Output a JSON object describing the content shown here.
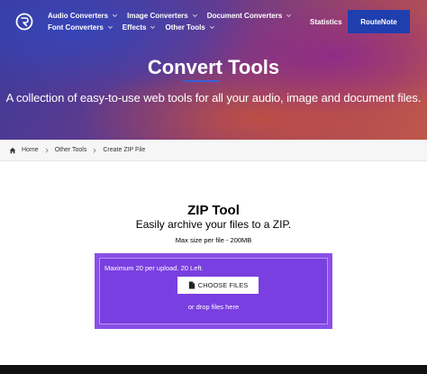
{
  "header": {
    "nav_row1": [
      {
        "label": "Audio Converters",
        "has_dropdown": true
      },
      {
        "label": "Image Converters",
        "has_dropdown": true
      },
      {
        "label": "Document Converters",
        "has_dropdown": true
      }
    ],
    "nav_row2": [
      {
        "label": "Font Converters",
        "has_dropdown": true
      },
      {
        "label": "Effects",
        "has_dropdown": true
      },
      {
        "label": "Other Tools",
        "has_dropdown": true
      }
    ],
    "statistics_label": "Statistics",
    "routenote_label": "RouteNote"
  },
  "hero": {
    "title": "Convert Tools",
    "subtitle": "A collection of easy-to-use web tools for all your audio, image and document files."
  },
  "breadcrumb": {
    "items": [
      "Home",
      "Other Tools",
      "Create ZIP File"
    ]
  },
  "tool": {
    "title": "ZIP Tool",
    "subtitle": "Easily archive your files to a ZIP.",
    "max_size": "Max size per file - 200MB",
    "upload_limit": "Maximum 20 per upload. 20 Left.",
    "choose_files_label": "CHOOSE FILES",
    "drop_text": "or drop files here"
  },
  "colors": {
    "brand_button": "#1f3fae",
    "dropzone": "#7a3fe0",
    "dropzone_border": "#8a4fe6"
  },
  "icons": {
    "logo": "routenote-logo-icon",
    "dropdown": "chevron-down-icon",
    "home": "home-icon",
    "separator": "chevron-right-icon",
    "file": "file-icon"
  }
}
